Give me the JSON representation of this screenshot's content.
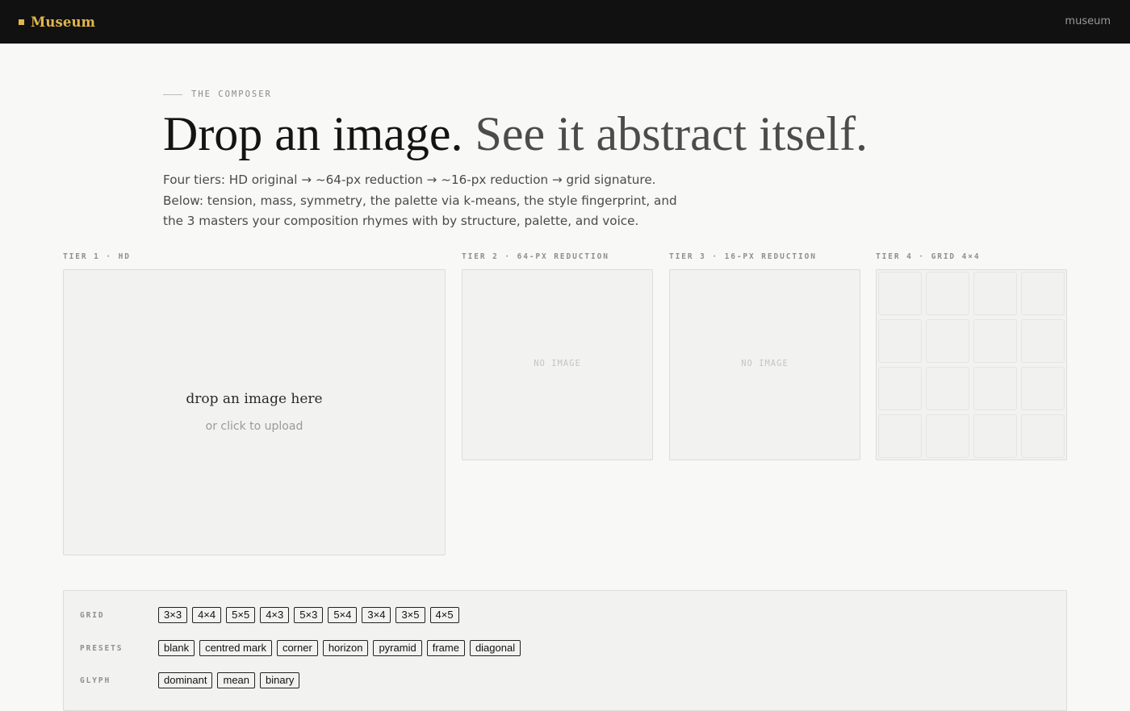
{
  "topbar": {
    "brand": "Museum",
    "link": "museum"
  },
  "hero": {
    "eyebrow": "THE COMPOSER",
    "headline_main": "Drop an image.",
    "headline_accent": "See it abstract itself.",
    "subhead_lines": [
      "Four tiers: HD original → ~64-px reduction → ~16-px reduction → grid signature.",
      "Below: tension, mass, symmetry, the palette via k-means, the style fingerprint, and",
      "the 3 masters your composition rhymes with by structure, palette, and voice."
    ]
  },
  "tiers": {
    "tier1": {
      "label": "TIER 1 · HD",
      "drop_title": "drop an image here",
      "drop_sub": "or click to upload"
    },
    "tier2": {
      "label": "TIER 2 · 64-PX REDUCTION",
      "empty": "NO IMAGE"
    },
    "tier3": {
      "label": "TIER 3 · 16-PX REDUCTION",
      "empty": "NO IMAGE"
    },
    "tier4": {
      "label": "TIER 4 · GRID 4×4"
    }
  },
  "controls": {
    "grid": {
      "label": "GRID",
      "options": [
        "3×3",
        "4×4",
        "5×5",
        "4×3",
        "5×3",
        "5×4",
        "3×4",
        "3×5",
        "4×5"
      ]
    },
    "presets": {
      "label": "PRESETS",
      "options": [
        "blank",
        "centred mark",
        "corner",
        "horizon",
        "pyramid",
        "frame",
        "diagonal"
      ]
    },
    "glyph": {
      "label": "GLYPH",
      "options": [
        "dominant",
        "mean",
        "binary"
      ]
    }
  },
  "colors": {
    "accent": "#e3b64a",
    "topbar_bg": "#111111",
    "page_bg": "#f8f8f6"
  }
}
